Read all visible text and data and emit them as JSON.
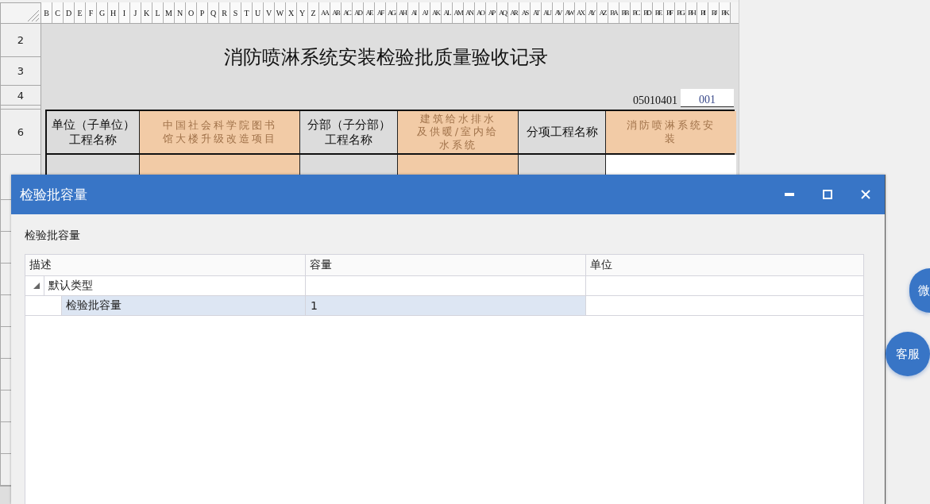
{
  "sheet": {
    "column_headers": [
      "B",
      "C",
      "D",
      "E",
      "F",
      "G",
      "H",
      "I",
      "J",
      "K",
      "L",
      "M",
      "N",
      "O",
      "P",
      "Q",
      "R",
      "S",
      "T",
      "U",
      "V",
      "W",
      "X",
      "Y",
      "Z",
      "AA",
      "AB",
      "AC",
      "AD",
      "AE",
      "AF",
      "AG",
      "AH",
      "AI",
      "AJ",
      "AK",
      "AL",
      "AM",
      "AN",
      "AO",
      "AP",
      "AQ",
      "AR",
      "AS",
      "AT",
      "AU",
      "AV",
      "AW",
      "AX",
      "AY",
      "AZ",
      "BA",
      "BB",
      "BC",
      "BD",
      "BE",
      "BF",
      "BG",
      "BH",
      "BI",
      "BJ",
      "BK"
    ],
    "row_headers": [
      "2",
      "3",
      "4",
      "6"
    ],
    "title": "消防喷淋系统安装检验批质量验收记录",
    "code": "05010401",
    "number": "001",
    "table_row": [
      {
        "kind": "label",
        "text": "单位（子单位）工程名称"
      },
      {
        "kind": "value",
        "text": "中国社会科学院图书馆大楼升级改造项目"
      },
      {
        "kind": "label",
        "text": "分部（子分部）工程名称"
      },
      {
        "kind": "value",
        "text": "建筑给水排水及供暖/室内给水系统"
      },
      {
        "kind": "label",
        "text": "分项工程名称"
      },
      {
        "kind": "value",
        "text": "消防喷淋系统安装"
      }
    ],
    "covered_row": [
      {
        "kind": "label"
      },
      {
        "kind": "value"
      },
      {
        "kind": "label"
      },
      {
        "kind": "value"
      },
      {
        "kind": "label"
      },
      {
        "kind": "input"
      }
    ]
  },
  "dialog": {
    "title": "检验批容量",
    "section_label": "检验批容量",
    "columns": [
      "描述",
      "容量",
      "单位"
    ],
    "tree": [
      {
        "description": "默认类型",
        "expanded": true,
        "selected": false,
        "children": [
          {
            "description": "检验批容量",
            "capacity": "1",
            "selected": true
          }
        ]
      }
    ]
  },
  "floating_buttons": [
    "微",
    "客服"
  ]
}
